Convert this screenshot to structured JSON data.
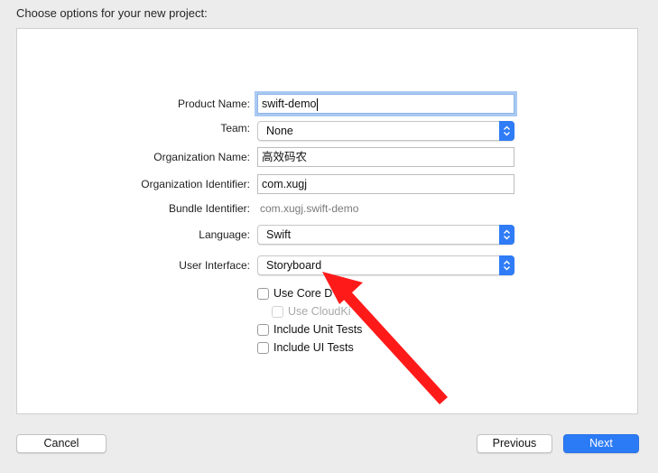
{
  "heading": "Choose options for your new project:",
  "form": {
    "product_name": {
      "label": "Product Name:",
      "value": "swift-demo"
    },
    "team": {
      "label": "Team:",
      "value": "None"
    },
    "organization_name": {
      "label": "Organization Name:",
      "value": "高效码农"
    },
    "organization_identifier": {
      "label": "Organization Identifier:",
      "value": "com.xugj"
    },
    "bundle_identifier": {
      "label": "Bundle Identifier:",
      "value": "com.xugj.swift-demo"
    },
    "language": {
      "label": "Language:",
      "value": "Swift"
    },
    "user_interface": {
      "label": "User Interface:",
      "value": "Storyboard"
    },
    "checkboxes": {
      "use_core_data": {
        "label": "Use Core D",
        "checked": false
      },
      "use_cloudkit": {
        "label": "Use CloudKi",
        "checked": false,
        "enabled": false
      },
      "include_unit_tests": {
        "label": "Include Unit Tests",
        "checked": false
      },
      "include_ui_tests": {
        "label": "Include UI Tests",
        "checked": false
      }
    }
  },
  "buttons": {
    "cancel": "Cancel",
    "previous": "Previous",
    "next": "Next"
  },
  "colors": {
    "accent": "#2c7bf6",
    "focus_ring": "#a9c9f2",
    "annotation_arrow": "#ff0000"
  }
}
